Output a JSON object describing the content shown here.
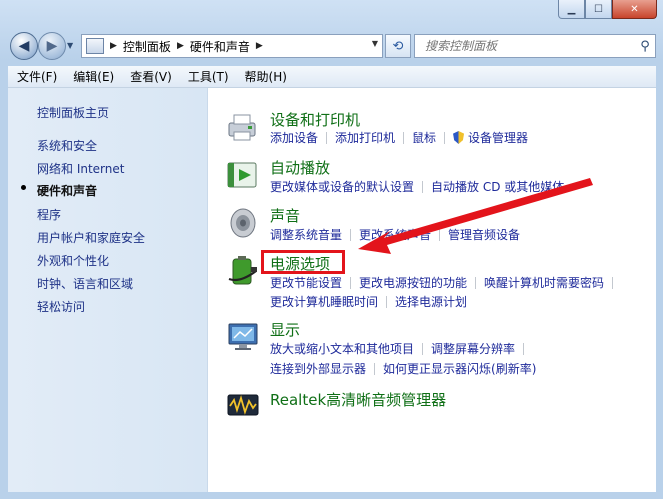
{
  "window": {
    "caption_buttons": [
      "minimize",
      "maximize",
      "close"
    ]
  },
  "nav": {
    "breadcrumbs": [
      "控制面板",
      "硬件和声音"
    ],
    "search_placeholder": "搜索控制面板"
  },
  "menubar": [
    "文件(F)",
    "编辑(E)",
    "查看(V)",
    "工具(T)",
    "帮助(H)"
  ],
  "sidebar": {
    "items": [
      {
        "label": "控制面板主页"
      },
      {
        "label": "系统和安全"
      },
      {
        "label": "网络和 Internet"
      },
      {
        "label": "硬件和声音",
        "active": true
      },
      {
        "label": "程序"
      },
      {
        "label": "用户帐户和家庭安全"
      },
      {
        "label": "外观和个性化"
      },
      {
        "label": "时钟、语言和区域"
      },
      {
        "label": "轻松访问"
      }
    ]
  },
  "categories": [
    {
      "title": "设备和打印机",
      "icon": "printer-icon",
      "rows": [
        [
          "添加设备",
          "添加打印机",
          "鼠标",
          "设备管理器"
        ]
      ]
    },
    {
      "title": "自动播放",
      "icon": "autoplay-icon",
      "rows": [
        [
          "更改媒体或设备的默认设置",
          "自动播放 CD 或其他媒体"
        ]
      ]
    },
    {
      "title": "声音",
      "icon": "speaker-icon",
      "rows": [
        [
          "调整系统音量",
          "更改系统声音",
          "管理音频设备"
        ]
      ]
    },
    {
      "title": "电源选项",
      "icon": "battery-icon",
      "rows": [
        [
          "更改节能设置",
          "更改电源按钮的功能",
          "唤醒计算机时需要密码"
        ],
        [
          "更改计算机睡眠时间",
          "选择电源计划"
        ]
      ]
    },
    {
      "title": "显示",
      "icon": "monitor-icon",
      "rows": [
        [
          "放大或缩小文本和其他项目",
          "调整屏幕分辨率"
        ],
        [
          "连接到外部显示器",
          "如何更正显示器闪烁(刷新率)"
        ]
      ]
    },
    {
      "title": "Realtek高清晰音频管理器",
      "icon": "realtek-audio-icon",
      "rows": []
    }
  ],
  "annotation": {
    "color": "#e3141b"
  },
  "colors": {
    "link": "#1e2a9a",
    "category_title": "#0f6f16"
  }
}
